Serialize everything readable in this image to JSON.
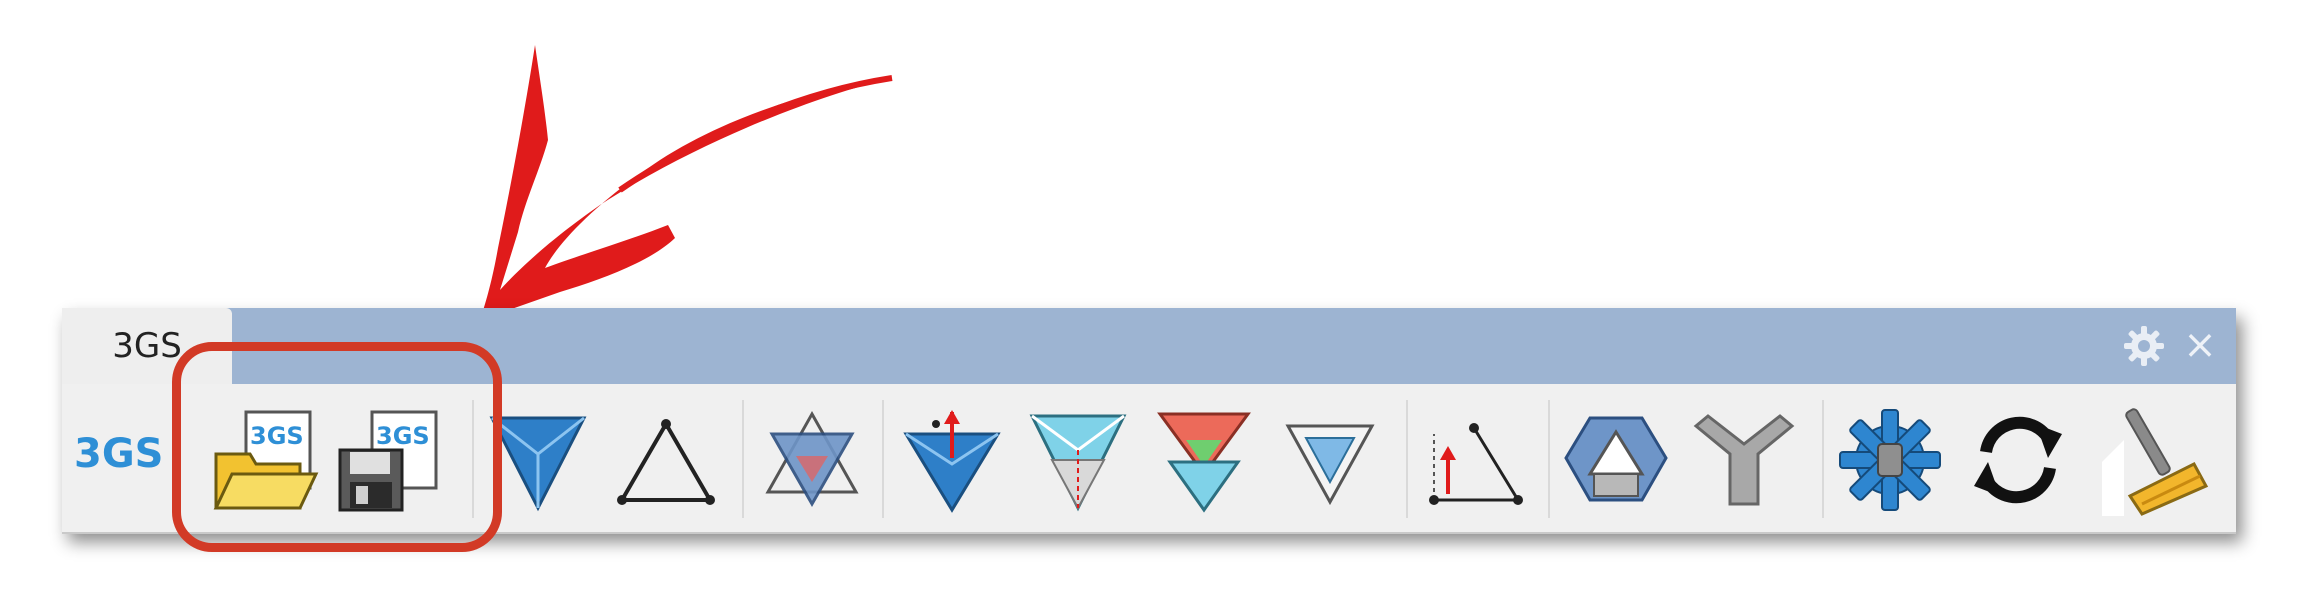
{
  "tab": {
    "label": "3GS"
  },
  "brand": {
    "label": "3GS"
  },
  "open_button": {
    "icon_text": "3GS"
  },
  "save_button": {
    "icon_text": "3GS"
  },
  "header_controls": {
    "settings": "gear-icon",
    "close": "×"
  },
  "icons": [
    "open-3gs-icon",
    "save-3gs-icon",
    "form-diagram-icon",
    "force-diagram-icon",
    "dual-diagram-icon",
    "load-icon",
    "reciprocal-icon",
    "funicular-icon",
    "inverted-triangle-icon",
    "support-icon",
    "polyhedron-icon",
    "branch-icon",
    "settings-gear-icon",
    "refresh-icon",
    "clear-broom-icon"
  ],
  "colors": {
    "tab_strip": "#9db4d2",
    "brand": "#2e8fd6",
    "highlight": "#d23a26",
    "arrow": "#e01b1b"
  }
}
